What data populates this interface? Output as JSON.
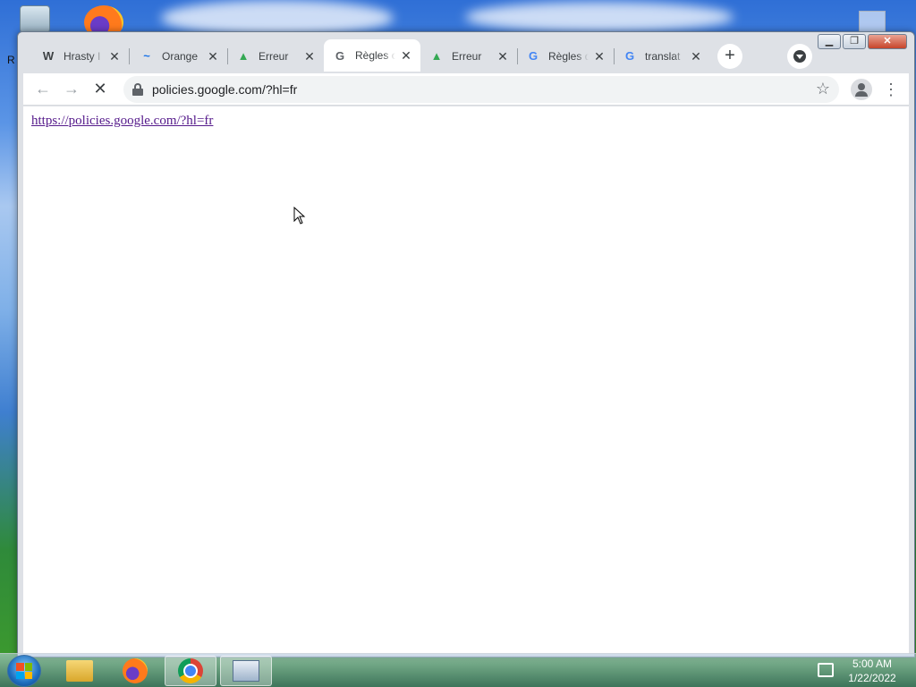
{
  "desktop": {
    "partial_label": "R"
  },
  "browser": {
    "tabs": [
      {
        "title": "Hrasty I",
        "favicon": "W",
        "favicon_color": "#111111",
        "active": false
      },
      {
        "title": "Orange",
        "favicon": "~",
        "favicon_color": "#1a73e8",
        "active": false
      },
      {
        "title": "Erreur",
        "favicon": "▲",
        "favicon_color": "#34a853",
        "active": false
      },
      {
        "title": "Règles c",
        "favicon": "G",
        "favicon_color": "#5f6368",
        "active": true
      },
      {
        "title": "Erreur",
        "favicon": "▲",
        "favicon_color": "#34a853",
        "active": false
      },
      {
        "title": "Règles d",
        "favicon": "G",
        "favicon_color": "#4285f4",
        "active": false
      },
      {
        "title": "translat",
        "favicon": "G",
        "favicon_color": "#4285f4",
        "active": false
      }
    ],
    "tab_close_glyph": "✕",
    "new_tab_glyph": "+",
    "window_controls": {
      "minimize": "▁",
      "maximize": "❐",
      "close": "✕"
    },
    "toolbar": {
      "back_glyph": "←",
      "forward_glyph": "→",
      "stop_glyph": "✕",
      "url": "policies.google.com/?hl=fr",
      "star_glyph": "☆",
      "menu_glyph": "⋮"
    },
    "content": {
      "link_text": "https://policies.google.com/?hl=fr"
    }
  },
  "taskbar": {
    "apps": [
      "folder-icon",
      "firefox-icon",
      "chrome-icon",
      "app-icon"
    ],
    "active_app": "chrome-icon",
    "clock_time": "5:00 AM",
    "clock_date": "1/22/2022"
  }
}
